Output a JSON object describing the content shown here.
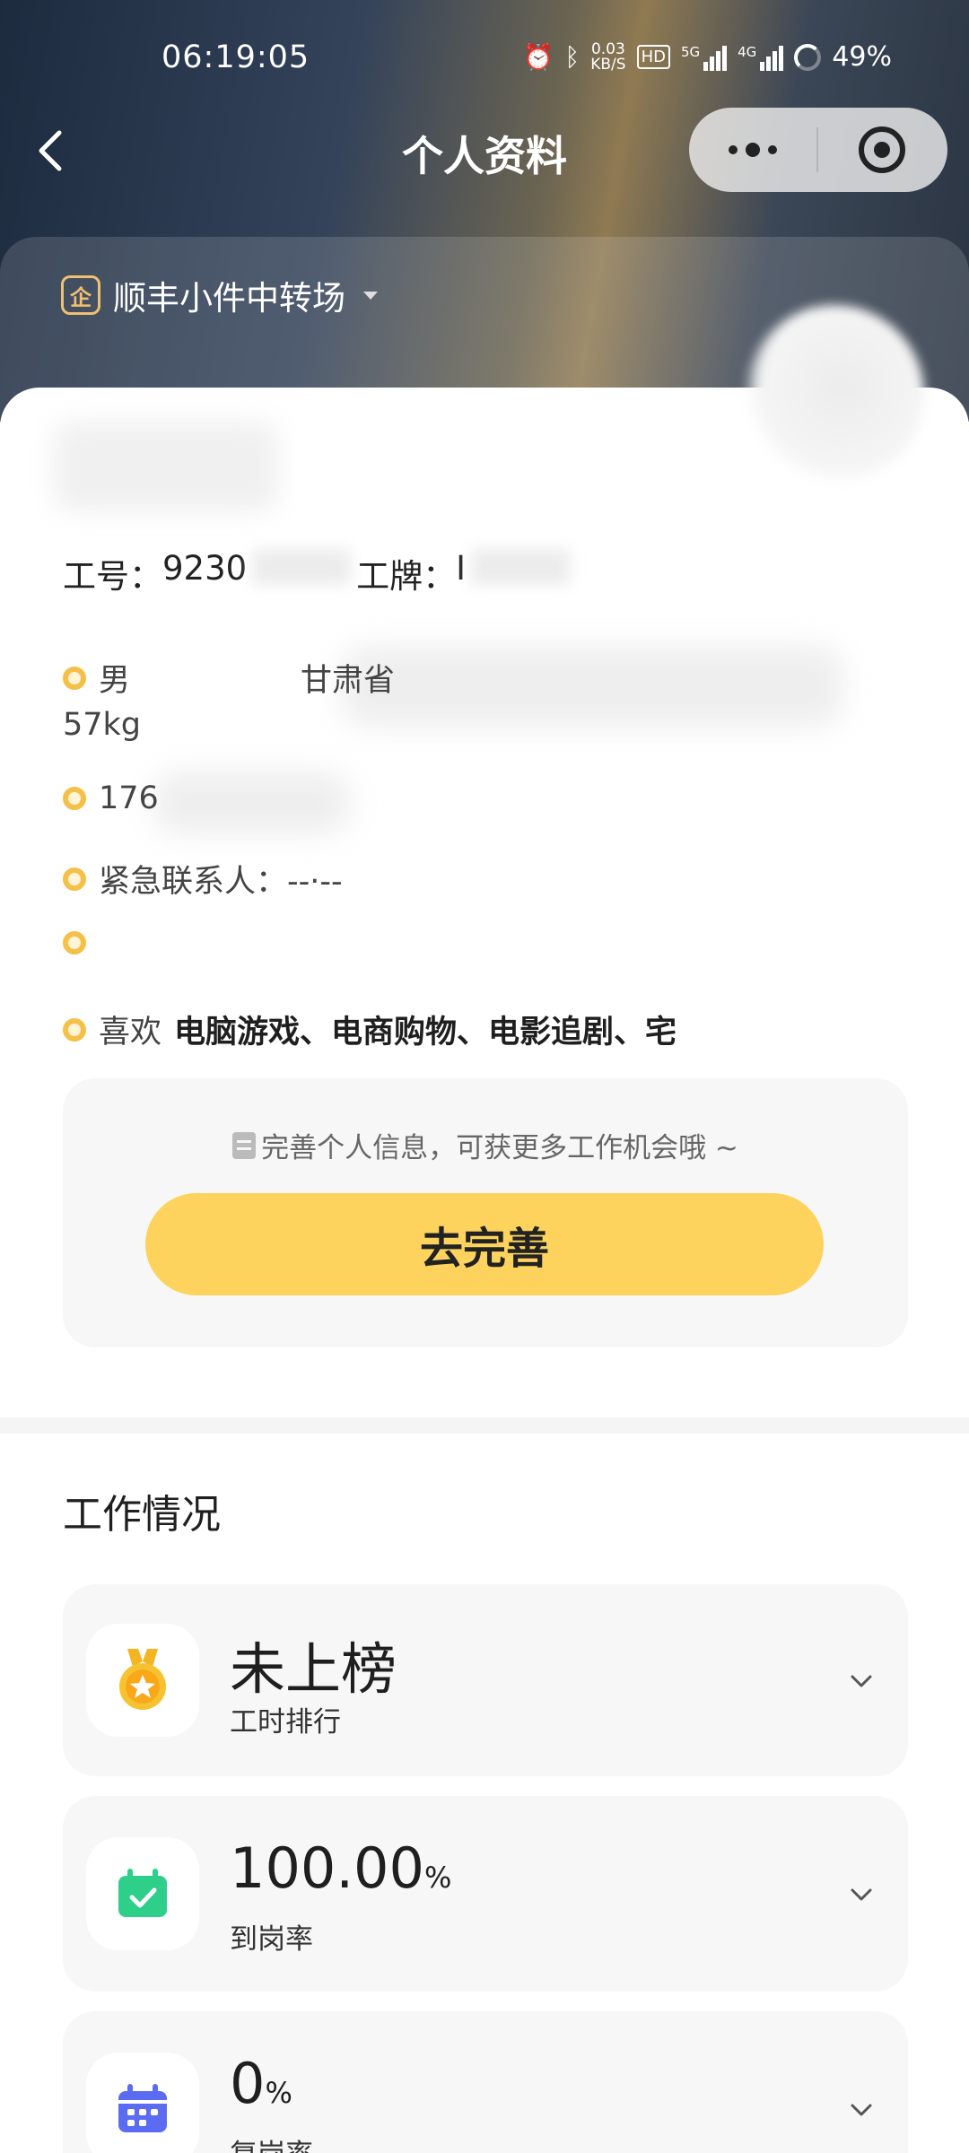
{
  "status_bar": {
    "time": "06:19:05",
    "net_speed_value": "0.03",
    "net_speed_unit": "KB/S",
    "hd_label": "HD",
    "signal1_label": "5G",
    "signal2_label": "4G",
    "battery": "49%"
  },
  "nav": {
    "title": "个人资料"
  },
  "company": {
    "icon_text": "企",
    "name": "顺丰小件中转场"
  },
  "profile": {
    "id_label": "工号：",
    "id_value": "9230",
    "badge_label": "工牌：",
    "badge_value": "I",
    "gender": "男",
    "province": "甘肃省",
    "weight": "57kg",
    "phone": "176",
    "emergency_contact": "紧急联系人：--·--",
    "hobby_prefix": "喜欢",
    "hobbies": "电脑游戏、电商购物、电影追剧、宅"
  },
  "complete": {
    "hint": "完善个人信息，可获更多工作机会哦 ~",
    "button_label": "去完善"
  },
  "work": {
    "section_title": "工作情况",
    "stats": [
      {
        "value": "未上榜",
        "unit": "",
        "label": "工时排行",
        "icon": "medal-icon"
      },
      {
        "value": "100.00",
        "unit": "%",
        "label": "到岗率",
        "icon": "calendar-check-icon"
      },
      {
        "value": "0",
        "unit": "%",
        "label": "复岗率",
        "icon": "calendar-icon"
      }
    ]
  },
  "colors": {
    "accent_yellow": "#fdd35e",
    "bullet": "#f5c04a",
    "card_bg": "#f7f7f7"
  }
}
